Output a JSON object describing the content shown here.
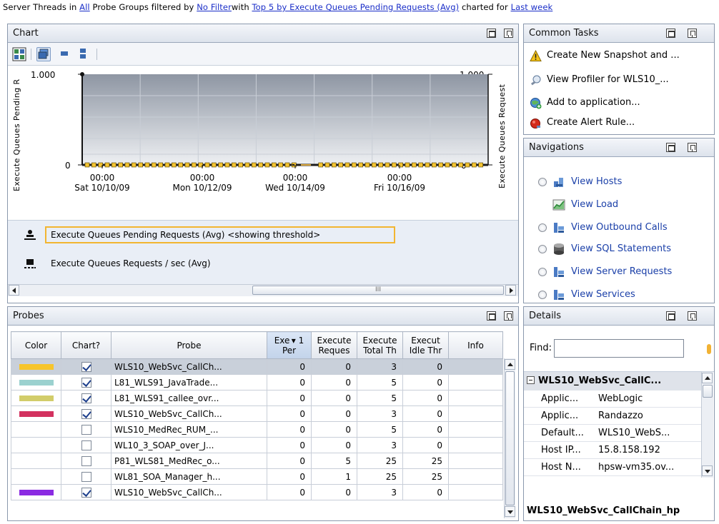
{
  "banner": {
    "t1": "Server Threads in ",
    "l1": "All",
    "t2": " Probe Groups filtered by ",
    "l2": "No Filter",
    "t3": "with ",
    "l3": "Top 5 by Execute Queues Pending Requests (Avg)",
    "t4": " charted for ",
    "l4": "Last week"
  },
  "chart_panel": {
    "title": "Chart",
    "y_left_title": "Execute Queues Pending R",
    "y_right_title": "Execute Queues Request",
    "y_left_ticks": [
      "1.000",
      "0"
    ],
    "y_right_ticks": [
      "1.000",
      "0"
    ],
    "x_ticks": [
      {
        "time": "00:00",
        "date": "Sat 10/10/09"
      },
      {
        "time": "00:00",
        "date": "Mon 10/12/09"
      },
      {
        "time": "00:00",
        "date": "Wed 10/14/09"
      },
      {
        "time": "00:00",
        "date": "Fri 10/16/09"
      }
    ],
    "legend": [
      "Execute Queues Pending Requests (Avg) <showing threshold>",
      "Execute Queues Requests / sec (Avg)"
    ],
    "scroll_grip": "III"
  },
  "chart_data": {
    "type": "line",
    "title": "",
    "ylabel": "Execute Queues Pending R",
    "ylabel_right": "Execute Queues Request",
    "xlabel": "",
    "x": [
      "Sat 10/10/09",
      "Mon 10/12/09",
      "Wed 10/14/09",
      "Fri 10/16/09"
    ],
    "ylim": [
      0,
      1.0
    ],
    "series": [
      {
        "name": "Execute Queues Pending Requests (Avg) <showing threshold>",
        "values": [
          0,
          0,
          0,
          0
        ]
      },
      {
        "name": "Execute Queues Requests / sec (Avg)",
        "values": [
          0,
          0,
          0,
          0
        ]
      }
    ],
    "grid": true,
    "legend_position": "bottom"
  },
  "common_tasks": {
    "title": "Common Tasks",
    "items": [
      {
        "label": "Create New Snapshot and ..."
      },
      {
        "label": "View Profiler for WLS10_..."
      },
      {
        "label": "Add to application..."
      },
      {
        "label": "Create Alert Rule..."
      }
    ]
  },
  "navigations": {
    "title": "Navigations",
    "items": [
      {
        "label": "View Hosts",
        "radio": true
      },
      {
        "label": "View Load",
        "radio": false
      },
      {
        "label": "View Outbound Calls",
        "radio": true
      },
      {
        "label": "View SQL Statements",
        "radio": true
      },
      {
        "label": "View Server Requests",
        "radio": true
      },
      {
        "label": "View Services",
        "radio": true
      }
    ]
  },
  "probes": {
    "title": "Probes",
    "columns": [
      "Color",
      "Chart?",
      "Probe",
      "Exe▾1 Per",
      "Execute Reques",
      "Execute Total Th",
      "Execut Idle Thr",
      "Info"
    ],
    "col_header_lines": [
      [
        "Color"
      ],
      [
        "Chart?"
      ],
      [
        "Probe"
      ],
      [
        "Exe ▾ 1",
        "Per"
      ],
      [
        "Execute",
        "Reques"
      ],
      [
        "Execute",
        "Total Th"
      ],
      [
        "Execut",
        "Idle Thr"
      ],
      [
        "Info"
      ]
    ],
    "rows": [
      {
        "color": "#f7c52b",
        "chart": true,
        "probe": "WLS10_WebSvc_CallCh...",
        "pending": "0",
        "requests": "0",
        "total": "3",
        "idle": "0",
        "info": ""
      },
      {
        "color": "#9bd1cf",
        "chart": true,
        "probe": "L81_WLS91_JavaTrade...",
        "pending": "0",
        "requests": "0",
        "total": "5",
        "idle": "0",
        "info": ""
      },
      {
        "color": "#d2cd6a",
        "chart": true,
        "probe": "L81_WLS91_callee_ovr...",
        "pending": "0",
        "requests": "0",
        "total": "5",
        "idle": "0",
        "info": ""
      },
      {
        "color": "#d3325f",
        "chart": true,
        "probe": "WLS10_WebSvc_CallCh...",
        "pending": "0",
        "requests": "0",
        "total": "3",
        "idle": "0",
        "info": ""
      },
      {
        "color": "",
        "chart": false,
        "probe": "WLS10_MedRec_RUM_...",
        "pending": "0",
        "requests": "0",
        "total": "5",
        "idle": "0",
        "info": ""
      },
      {
        "color": "",
        "chart": false,
        "probe": "WL10_3_SOAP_over_J...",
        "pending": "0",
        "requests": "0",
        "total": "3",
        "idle": "0",
        "info": ""
      },
      {
        "color": "",
        "chart": false,
        "probe": "P81_WLS81_MedRec_o...",
        "pending": "0",
        "requests": "5",
        "total": "25",
        "idle": "25",
        "info": ""
      },
      {
        "color": "",
        "chart": false,
        "probe": "WL81_SOA_Manager_h...",
        "pending": "0",
        "requests": "1",
        "total": "25",
        "idle": "25",
        "info": ""
      },
      {
        "color": "#8b2be2",
        "chart": true,
        "probe": "WLS10_WebSvc_CallCh...",
        "pending": "0",
        "requests": "0",
        "total": "3",
        "idle": "0",
        "info": ""
      }
    ]
  },
  "details": {
    "title": "Details",
    "find_label": "Find:",
    "find_value": "",
    "group": "WLS10_WebSvc_CallC...",
    "rows": [
      {
        "key": "Applic...",
        "value": "WebLogic"
      },
      {
        "key": "Applic...",
        "value": "Randazzo"
      },
      {
        "key": "Default...",
        "value": "WLS10_WebS..."
      },
      {
        "key": "Host IP...",
        "value": "15.8.158.192"
      },
      {
        "key": "Host N...",
        "value": "hpsw-vm35.ov..."
      }
    ],
    "footer": "WLS10_WebSvc_CallChain_hp"
  }
}
